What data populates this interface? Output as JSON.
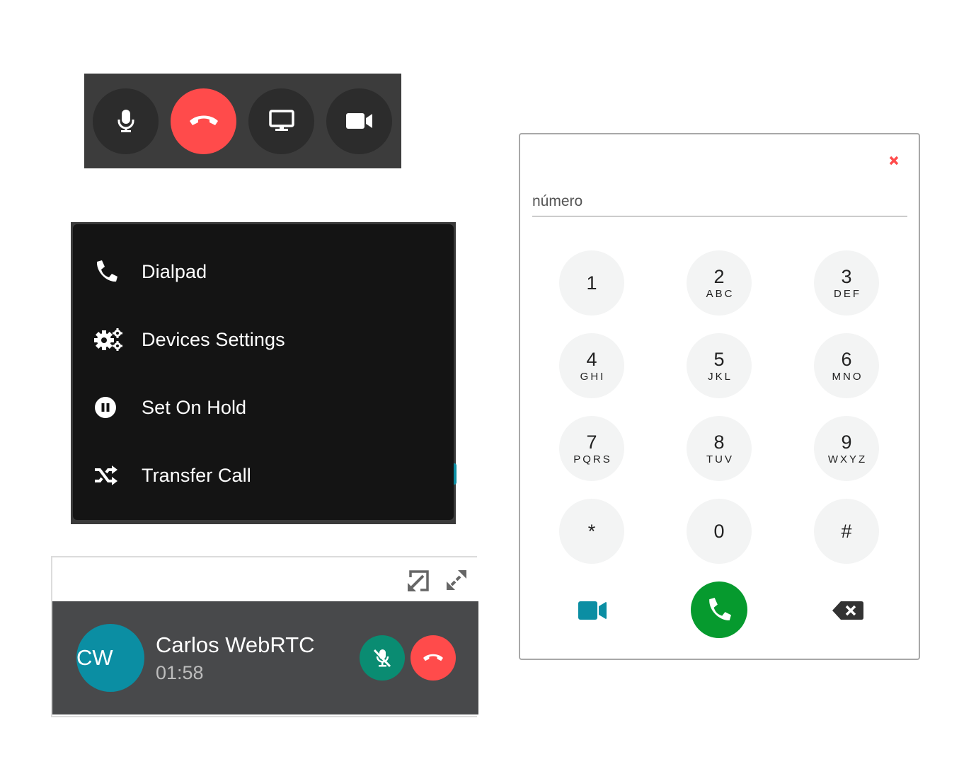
{
  "call_bar": {
    "buttons": [
      {
        "name": "microphone",
        "icon": "microphone-icon"
      },
      {
        "name": "hang-up",
        "icon": "phone-hangup-icon",
        "color": "#ff4b4b"
      },
      {
        "name": "screen-share",
        "icon": "monitor-icon"
      },
      {
        "name": "video",
        "icon": "video-camera-icon"
      }
    ]
  },
  "menu": {
    "items": [
      {
        "label": "Dialpad",
        "icon": "phone-icon"
      },
      {
        "label": "Devices Settings",
        "icon": "gears-icon"
      },
      {
        "label": "Set On Hold",
        "icon": "pause-circle-icon"
      },
      {
        "label": "Transfer Call",
        "icon": "shuffle-icon"
      }
    ]
  },
  "call_widget": {
    "avatar_initials": "CW",
    "avatar_color": "#0b8ea3",
    "caller_name": "Carlos WebRTC",
    "timer": "01:58",
    "mute_color": "#0a8c72",
    "hangup_color": "#ff4b4b",
    "top_icons": [
      "compress-icon",
      "expand-icon"
    ]
  },
  "dialpad": {
    "close_icon": "close-icon",
    "input": {
      "placeholder": "número",
      "value": ""
    },
    "keys": [
      {
        "digit": "1",
        "letters": ""
      },
      {
        "digit": "2",
        "letters": "ABC"
      },
      {
        "digit": "3",
        "letters": "DEF"
      },
      {
        "digit": "4",
        "letters": "GHI"
      },
      {
        "digit": "5",
        "letters": "JKL"
      },
      {
        "digit": "6",
        "letters": "MNO"
      },
      {
        "digit": "7",
        "letters": "PQRS"
      },
      {
        "digit": "8",
        "letters": "TUV"
      },
      {
        "digit": "9",
        "letters": "WXYZ"
      },
      {
        "digit": "*",
        "letters": ""
      },
      {
        "digit": "0",
        "letters": ""
      },
      {
        "digit": "#",
        "letters": ""
      }
    ],
    "call_color": "#069a2e",
    "video_color": "#0b8ea3"
  }
}
